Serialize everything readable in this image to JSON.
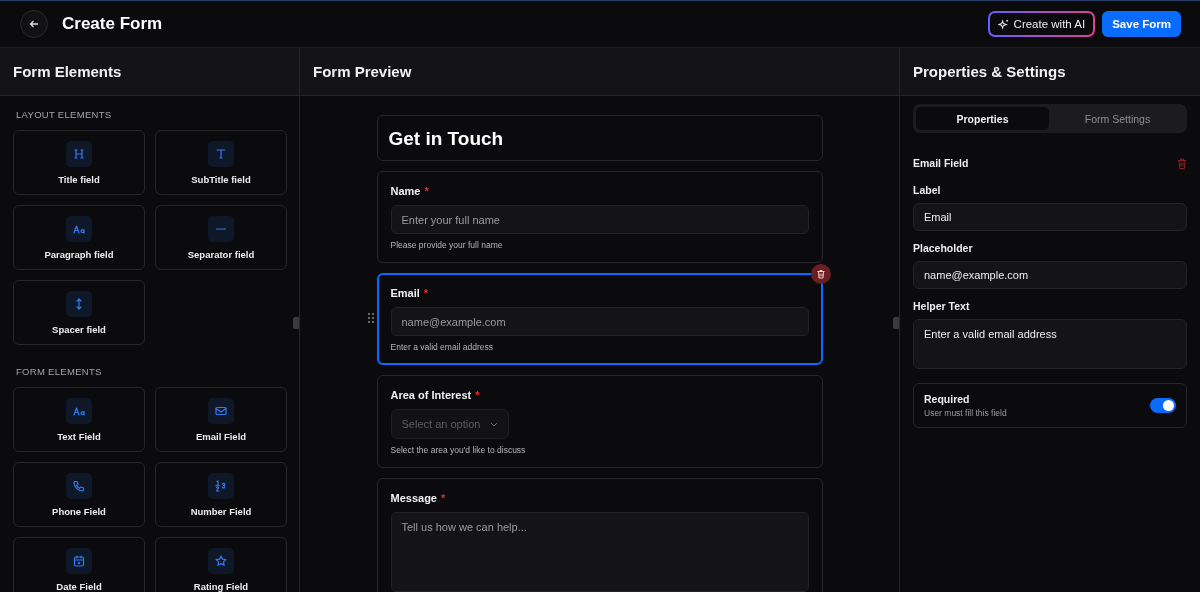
{
  "header": {
    "title": "Create Form",
    "buttons": [
      {
        "label": "Create with AI",
        "kind": "ai"
      },
      {
        "label": "Save Form",
        "kind": "primary"
      }
    ]
  },
  "elements_panel": {
    "title": "Form Elements",
    "sections": [
      {
        "heading": "LAYOUT ELEMENTS",
        "items": [
          {
            "label": "Title field",
            "kind": "title"
          },
          {
            "label": "SubTitle field",
            "kind": "subtitle"
          },
          {
            "label": "Paragraph field",
            "kind": "paragraph"
          },
          {
            "label": "Separator field",
            "kind": "separator"
          },
          {
            "label": "Spacer field",
            "kind": "spacer"
          }
        ]
      },
      {
        "heading": "FORM ELEMENTS",
        "items": [
          {
            "label": "Text Field",
            "kind": "text"
          },
          {
            "label": "Email Field",
            "kind": "email"
          },
          {
            "label": "Phone Field",
            "kind": "phone"
          },
          {
            "label": "Number Field",
            "kind": "number"
          },
          {
            "label": "Date Field",
            "kind": "date"
          },
          {
            "label": "Rating Field",
            "kind": "rating"
          }
        ]
      }
    ]
  },
  "preview": {
    "title": "Form Preview",
    "form_title": "Get in Touch",
    "fields": [
      {
        "kind": "input",
        "label": "Name",
        "required_mark": "*",
        "placeholder": "Enter your full name",
        "helper": "Please provide your full name",
        "selected": false
      },
      {
        "kind": "input",
        "label": "Email",
        "required_mark": "*",
        "placeholder": "name@example.com",
        "helper": "Enter a valid email address",
        "selected": true
      },
      {
        "kind": "select",
        "label": "Area of Interest",
        "required_mark": "*",
        "placeholder": "Select an option",
        "helper": "Select the area you'd like to discuss",
        "selected": false
      },
      {
        "kind": "textarea",
        "label": "Message",
        "required_mark": "*",
        "placeholder": "Tell us how we can help...",
        "selected": false
      }
    ]
  },
  "properties": {
    "title": "Properties & Settings",
    "tabs": [
      {
        "label": "Properties",
        "selected": true
      },
      {
        "label": "Form Settings",
        "selected": false
      }
    ],
    "field_title": "Email Field",
    "props": [
      {
        "label": "Label",
        "value": "Email",
        "kind": "input"
      },
      {
        "label": "Placeholder",
        "value": "name@example.com",
        "kind": "input"
      },
      {
        "label": "Helper Text",
        "value": "Enter a valid email address",
        "kind": "textarea"
      }
    ],
    "required": {
      "label": "Required",
      "description": "User must fill this field",
      "on": true
    }
  }
}
